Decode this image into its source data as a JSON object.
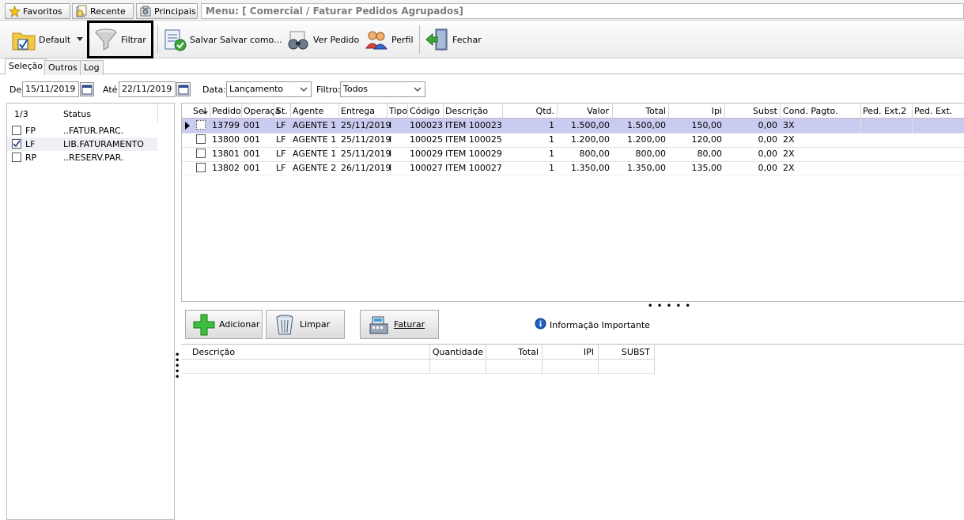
{
  "top_tabs": {
    "favoritos": "Favoritos",
    "recente": "Recente",
    "principais": "Principais"
  },
  "menu_path": "Menu: [ Comercial / Faturar Pedidos Agrupados]",
  "toolbar": {
    "default": "Default",
    "filtrar": "Filtrar",
    "salvar": "Salvar",
    "salvar_como": "Salvar como...",
    "ver_pedido": "Ver Pedido",
    "perfil": "Perfil",
    "fechar": "Fechar"
  },
  "page_tabs": [
    "Seleção",
    "Outros",
    "Log"
  ],
  "filters": {
    "de_label": "De",
    "de_value": "15/11/2019",
    "ate_label": "Até",
    "ate_value": "22/11/2019",
    "data_label": "Data:",
    "data_value": "Lançamento",
    "filtro_label": "Filtro:",
    "filtro_value": "Todos"
  },
  "status_panel": {
    "counter": "1/3",
    "header": "Status",
    "rows": [
      {
        "code": "FP",
        "desc": "..FATUR.PARC.",
        "checked": false
      },
      {
        "code": "LF",
        "desc": "LIB.FATURAMENTO",
        "checked": true
      },
      {
        "code": "RP",
        "desc": "..RESERV.PAR.",
        "checked": false
      }
    ]
  },
  "grid": {
    "headers": {
      "sel": "Sel",
      "pedido": "Pedido",
      "operacao": "Operaçã",
      "st": "St.",
      "agente": "Agente",
      "entrega": "Entrega",
      "tipo": "Tipo",
      "codigo": "Código",
      "descricao": "Descrição",
      "qtd": "Qtd.",
      "valor": "Valor",
      "total": "Total",
      "ipi": "Ipi",
      "subst": "Subst",
      "cond": "Cond. Pagto.",
      "ped_ext2": "Ped. Ext.2",
      "ped_ext": "Ped. Ext."
    },
    "rows": [
      {
        "pedido": "13799",
        "operacao": "001",
        "st": "LF",
        "agente": "AGENTE 1",
        "entrega": "25/11/2019",
        "tipo": "I",
        "codigo": "100023",
        "descricao": "ITEM 100023",
        "qtd": "1",
        "valor": "1.500,00",
        "total": "1.500,00",
        "ipi": "150,00",
        "subst": "0,00",
        "cond": "3X"
      },
      {
        "pedido": "13800",
        "operacao": "001",
        "st": "LF",
        "agente": "AGENTE 1",
        "entrega": "25/11/2019",
        "tipo": "I",
        "codigo": "100025",
        "descricao": "ITEM 100025",
        "qtd": "1",
        "valor": "1.200,00",
        "total": "1.200,00",
        "ipi": "120,00",
        "subst": "0,00",
        "cond": "2X"
      },
      {
        "pedido": "13801",
        "operacao": "001",
        "st": "LF",
        "agente": "AGENTE 1",
        "entrega": "25/11/2019",
        "tipo": "I",
        "codigo": "100029",
        "descricao": "ITEM 100029",
        "qtd": "1",
        "valor": "800,00",
        "total": "800,00",
        "ipi": "80,00",
        "subst": "0,00",
        "cond": "2X"
      },
      {
        "pedido": "13802",
        "operacao": "001",
        "st": "LF",
        "agente": "AGENTE 2",
        "entrega": "26/11/2019",
        "tipo": "I",
        "codigo": "100027",
        "descricao": "ITEM 100027",
        "qtd": "1",
        "valor": "1.350,00",
        "total": "1.350,00",
        "ipi": "135,00",
        "subst": "0,00",
        "cond": "2X"
      }
    ]
  },
  "actions": {
    "adicionar": "Adicionar",
    "limpar": "Limpar",
    "faturar": "Faturar",
    "info": "Informação Importante"
  },
  "bottom_grid": {
    "headers": {
      "descricao": "Descrição",
      "quantidade": "Quantidade",
      "total": "Total",
      "ipi": "IPI",
      "subst": "SUBST"
    }
  },
  "colors": {
    "selected_row": "#c9cbf0",
    "add_green": "#2fa82f",
    "info_blue": "#1f5fbf"
  }
}
